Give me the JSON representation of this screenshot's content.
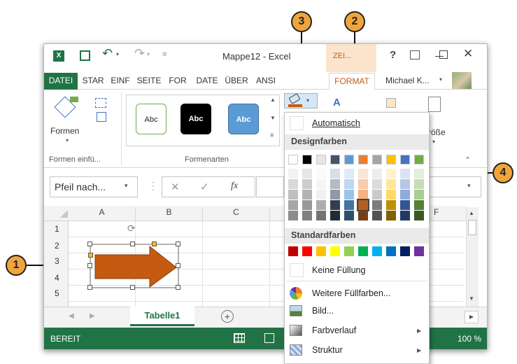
{
  "title": {
    "doc": "Mappe12 - Excel",
    "contextual": "ZEI...",
    "help": "?",
    "user": "Michael K..."
  },
  "tabs": [
    "DATEI",
    "STAR",
    "EINF",
    "SEITE",
    "FOR",
    "DATE",
    "ÜBER",
    "ANSI",
    "FORMAT"
  ],
  "ribbon": {
    "shapes_label": "Formen",
    "group1_label": "Formen einfü...",
    "group2_label": "Formenarten",
    "style_sample": "Abc",
    "size_label": "röße"
  },
  "formula": {
    "namebox": "Pfeil nach...",
    "fx": "fx"
  },
  "grid": {
    "columns": [
      "A",
      "B",
      "C"
    ],
    "col_f": "F",
    "rows": [
      "1",
      "2",
      "3",
      "4",
      "5"
    ]
  },
  "sheet": {
    "tab": "Tabelle1",
    "status": "BEREIT",
    "zoom": "100 %"
  },
  "menu": {
    "automatic": "Automatisch",
    "theme_header": "Designfarben",
    "standard_header": "Standardfarben",
    "no_fill": "Keine Füllung",
    "more": "Weitere Füllfarben...",
    "picture": "Bild...",
    "gradient": "Farbverlauf",
    "texture": "Struktur"
  },
  "colors": {
    "theme": [
      "#ffffff",
      "#000000",
      "#e7e6e6",
      "#44546a",
      "#5b9bd5",
      "#ed7d31",
      "#a5a5a5",
      "#ffc000",
      "#4472c4",
      "#70ad47"
    ],
    "standard": [
      "#c00000",
      "#ff0000",
      "#ffc000",
      "#ffff00",
      "#92d050",
      "#00b050",
      "#00b0f0",
      "#0070c0",
      "#002060",
      "#7030a0"
    ],
    "excel_green": "#217346",
    "arrow_fill": "#c55a11",
    "callout": "#f0a53c"
  },
  "callouts": [
    "1",
    "2",
    "3",
    "4"
  ]
}
